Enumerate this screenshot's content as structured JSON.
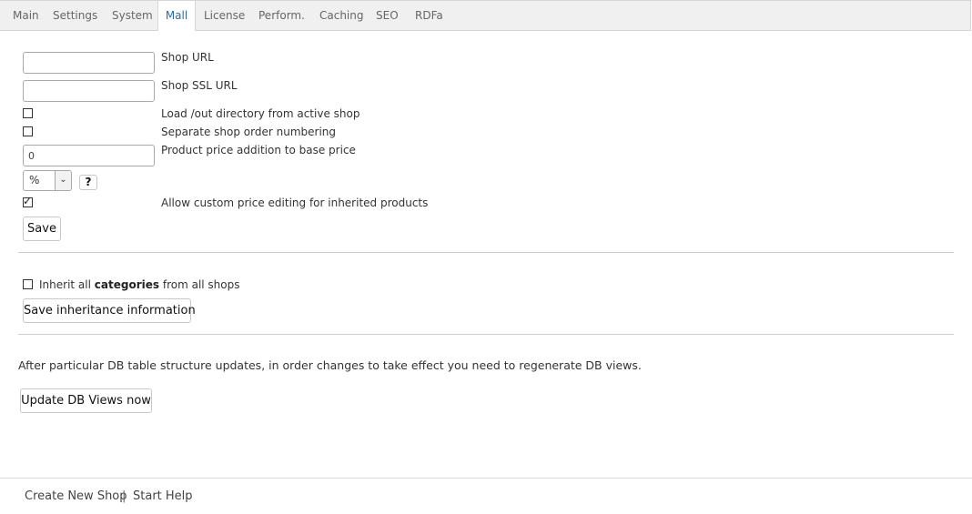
{
  "tabs": [
    {
      "label": "Main"
    },
    {
      "label": "Settings"
    },
    {
      "label": "System"
    },
    {
      "label": "Mall",
      "active": true
    },
    {
      "label": "License"
    },
    {
      "label": "Perform."
    },
    {
      "label": "Caching"
    },
    {
      "label": "SEO"
    },
    {
      "label": "RDFa"
    }
  ],
  "form": {
    "shop_url": {
      "label": "Shop URL",
      "value": ""
    },
    "shop_ssl_url": {
      "label": "Shop SSL URL",
      "value": ""
    },
    "load_out_dir": {
      "label": "Load /out directory from active shop",
      "checked": false
    },
    "separate_order_numbering": {
      "label": "Separate shop order numbering",
      "checked": false
    },
    "price_addition": {
      "label": "Product price addition to base price",
      "value": "0"
    },
    "price_unit": {
      "selected": "%"
    },
    "help_label": "?",
    "allow_custom_price": {
      "label": "Allow custom price editing for inherited products",
      "checked": true
    },
    "save_label": "Save"
  },
  "inheritance": {
    "label_prefix": "Inherit all",
    "label_bold": "categories",
    "label_suffix": "from all shops",
    "checked": false,
    "save_label": "Save inheritance information"
  },
  "db_views": {
    "info": "After particular DB table structure updates, in order changes to take effect you need to regenerate DB views.",
    "button_label": "Update DB Views now"
  },
  "footer": {
    "create_shop": "Create New Shop",
    "separator": "|",
    "start_help": "Start Help"
  },
  "colors": {
    "active_tab_text": "#2d6aa3",
    "tab_bar_bg": "#f0f0f0"
  }
}
